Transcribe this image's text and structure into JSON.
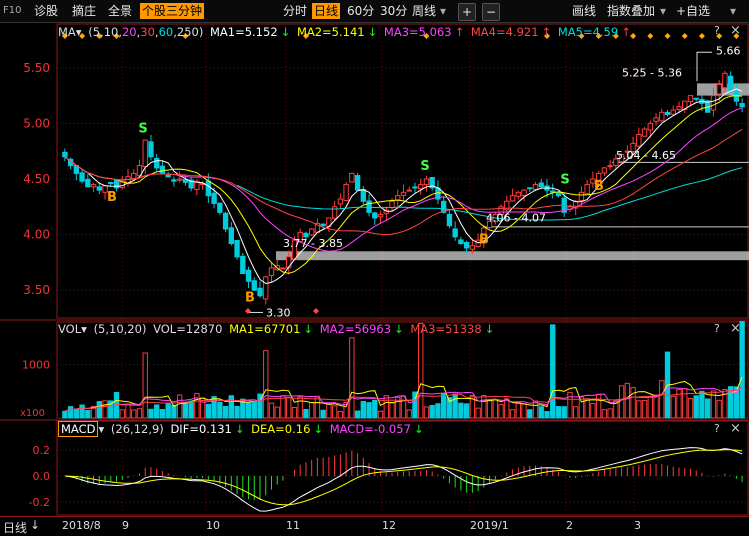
{
  "toolbar": {
    "f10": "F10",
    "diagnose": "诊股",
    "pick": "摘庄",
    "overview": "全景",
    "three_min": "个股三分钟",
    "timeshare": "分时",
    "daily": "日线",
    "m60": "60分",
    "m30": "30分",
    "weekly": "周线",
    "plus": "+",
    "minus": "−",
    "draw": "画线",
    "index_overlay": "指数叠加",
    "add_watch": "+自选"
  },
  "ma_legend": {
    "name": "MA",
    "params_prefix": "(5,10,",
    "p20": "20",
    "p30": "30",
    "p60": "60",
    "p250": "250)",
    "ma1": "MA1=5.152",
    "ma2": "MA2=5.141",
    "ma3": "MA3=5.063",
    "ma4": "MA4=4.921",
    "ma5": "MA5=4.59",
    "ma1_color": "#ffffff",
    "ma2_color": "#ffff00",
    "ma3_color": "#ff44ff",
    "ma4_color": "#ff4444",
    "ma5_color": "#00dddd"
  },
  "vol_legend": {
    "name": "VOL",
    "params": "(5,10,20)",
    "vol": "VOL=12870",
    "ma1": "MA1=67701",
    "ma2": "MA2=56963",
    "ma3": "MA3=51338"
  },
  "macd_legend": {
    "name": "MACD",
    "params": "(26,12,9)",
    "dif": "DIF=0.131",
    "dea": "DEA=0.16",
    "macd": "MACD=-0.057"
  },
  "panel_controls": {
    "help": "?",
    "close": "×"
  },
  "price_axis": [
    "5.50",
    "5.00",
    "4.50",
    "4.00",
    "3.50"
  ],
  "vol_axis": {
    "tick": "1000",
    "unit": "x100"
  },
  "macd_axis": [
    "0.2",
    "0.0",
    "-0.2"
  ],
  "annotations": {
    "high": "5.66",
    "range1": "5.25 - 5.36",
    "range2": "5.04 - 4.65",
    "range3": "4.06 - 4.07",
    "range4": "3.77 - 3.85",
    "low": "3.30"
  },
  "signals": {
    "buy": "B",
    "sell": "S"
  },
  "bottom": {
    "period": "日线",
    "months": [
      "2018/8",
      "9",
      "10",
      "11",
      "12",
      "2019/1",
      "2",
      "3"
    ]
  },
  "chart_data": {
    "type": "candlestick",
    "price_ylim": [
      3.25,
      5.75
    ],
    "price_ticks": [
      3.5,
      4.0,
      4.5,
      5.0,
      5.5
    ],
    "high": 5.66,
    "low": 3.3,
    "support_resistance_zones": [
      "5.25 - 5.36",
      "5.04 - 4.65",
      "4.06 - 4.07",
      "3.77 - 3.85"
    ],
    "ma_last": {
      "MA1": 5.152,
      "MA2": 5.141,
      "MA3": 5.063,
      "MA4": 4.921,
      "MA5": 4.59
    },
    "close_approx": [
      4.7,
      4.62,
      4.55,
      4.48,
      4.43,
      4.45,
      4.4,
      4.44,
      4.46,
      4.42,
      4.48,
      4.52,
      4.55,
      4.62,
      4.85,
      4.7,
      4.6,
      4.55,
      4.52,
      4.48,
      4.5,
      4.47,
      4.42,
      4.48,
      4.46,
      4.35,
      4.28,
      4.2,
      4.05,
      3.92,
      3.8,
      3.65,
      3.58,
      3.5,
      3.45,
      3.62,
      3.7,
      3.72,
      3.7,
      3.8,
      3.95,
      4.02,
      3.98,
      4.05,
      4.1,
      4.08,
      4.15,
      4.25,
      4.32,
      4.45,
      4.55,
      4.4,
      4.3,
      4.2,
      4.15,
      4.18,
      4.22,
      4.3,
      4.35,
      4.38,
      4.4,
      4.42,
      4.45,
      4.5,
      4.42,
      4.32,
      4.2,
      4.08,
      3.98,
      3.92,
      3.88,
      3.9,
      3.95,
      4.06,
      4.12,
      4.18,
      4.25,
      4.3,
      4.35,
      4.38,
      4.4,
      4.42,
      4.45,
      4.43,
      4.4,
      4.38,
      4.35,
      4.2,
      4.25,
      4.3,
      4.38,
      4.45,
      4.5,
      4.55,
      4.6,
      4.62,
      4.68,
      4.72,
      4.75,
      4.82,
      4.9,
      4.95,
      5.0,
      5.05,
      5.1,
      5.08,
      5.12,
      5.15,
      5.2,
      5.25,
      5.22,
      5.18,
      5.1,
      5.25,
      5.35,
      5.45,
      5.3,
      5.2,
      5.15
    ],
    "volume_ytick": 1000,
    "volume_unit": "x100",
    "vol_last": {
      "VOL": 12870,
      "MA1": 67701,
      "MA2": 56963,
      "MA3": 51338
    },
    "macd_ylim": [
      -0.3,
      0.3
    ],
    "macd_ticks": [
      0.2,
      0.0,
      -0.2
    ],
    "macd_last": {
      "DIF": 0.131,
      "DEA": 0.16,
      "MACD": -0.057
    },
    "x_months": [
      "2018/8",
      "9",
      "10",
      "11",
      "12",
      "2019/1",
      "2",
      "3"
    ]
  }
}
